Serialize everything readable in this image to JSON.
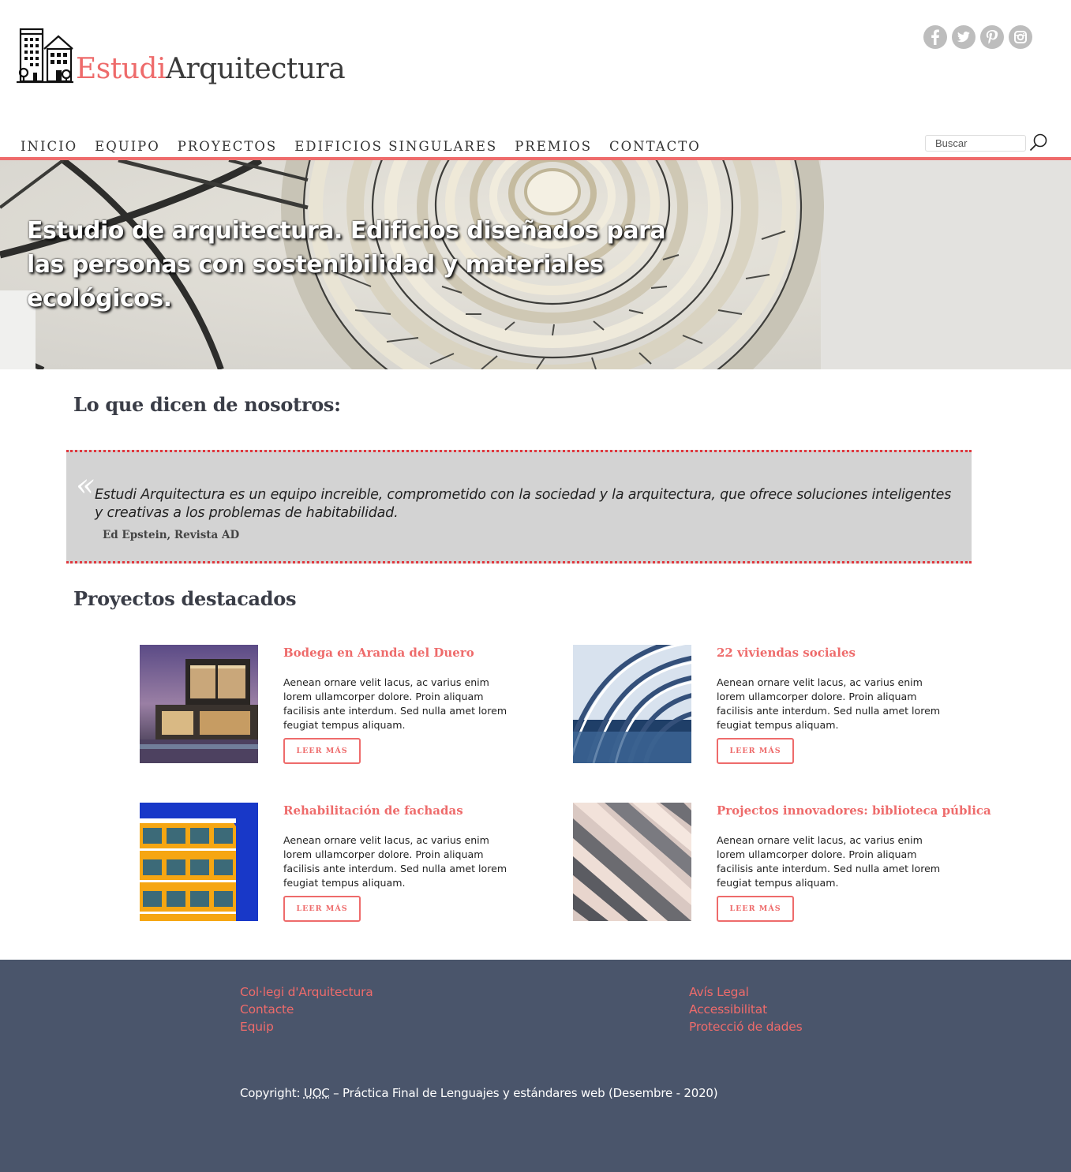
{
  "brand": {
    "part1": "Estudi",
    "part2": "Arquitectura",
    "colors": {
      "accent": "#ee6b6b",
      "dark": "#3b3b3b"
    }
  },
  "social": [
    {
      "icon": "facebook-icon",
      "glyph": "f"
    },
    {
      "icon": "twitter-icon",
      "glyph": "t"
    },
    {
      "icon": "pinterest-icon",
      "glyph": "p"
    },
    {
      "icon": "instagram-icon",
      "glyph": "◻"
    }
  ],
  "nav": {
    "items": [
      "INICIO",
      "EQUIPO",
      "PROYECTOS",
      "EDIFICIOS SINGULARES",
      "PREMIOS",
      "CONTACTO"
    ]
  },
  "search": {
    "placeholder": "Buscar"
  },
  "hero": {
    "title": "Estudio de arquitectura. Edificios diseñados para las personas con sostenibilidad y materiales ecológicos."
  },
  "testimonials": {
    "heading": "Lo que dicen de nosotros:",
    "quote_mark": "«",
    "quote": "Estudi Arquitectura es un equipo increible, comprometido con la sociedad y la arquitectura, que ofrece soluciones inteligentes y creativas a los problemas de habitabilidad.",
    "author": "Ed Epstein, Revista AD"
  },
  "projects": {
    "heading": "Proyectos destacados",
    "button_label": "LEER MÁS",
    "items": [
      {
        "title": "Bodega en Aranda del Duero",
        "description": "Aenean ornare velit lacus, ac varius enim lorem ullamcorper dolore. Proin aliquam facilisis ante interdum. Sed nulla amet lorem feugiat tempus aliquam."
      },
      {
        "title": "22 viviendas sociales",
        "description": "Aenean ornare velit lacus, ac varius enim lorem ullamcorper dolore. Proin aliquam facilisis ante interdum. Sed nulla amet lorem feugiat tempus aliquam."
      },
      {
        "title": "Rehabilitación de fachadas",
        "description": "Aenean ornare velit lacus, ac varius enim lorem ullamcorper dolore. Proin aliquam facilisis ante interdum. Sed nulla amet lorem feugiat tempus aliquam."
      },
      {
        "title": "Projectos innovadores: biblioteca pública",
        "description": "Aenean ornare velit lacus, ac varius enim lorem ullamcorper dolore. Proin aliquam facilisis ante interdum. Sed nulla amet lorem feugiat tempus aliquam."
      }
    ]
  },
  "footer": {
    "col1": [
      "Col·legi d'Arquitectura",
      "Contacte",
      "Equip"
    ],
    "col2": [
      "Avís Legal",
      "Accessibilitat",
      "Protecció de dades"
    ],
    "copyright_prefix": "Copyright: ",
    "copyright_abbr": "UOC",
    "copyright_suffix": " – Práctica Final de Lenguajes y estándares web (Desembre - 2020)",
    "background": "#4a556b"
  }
}
